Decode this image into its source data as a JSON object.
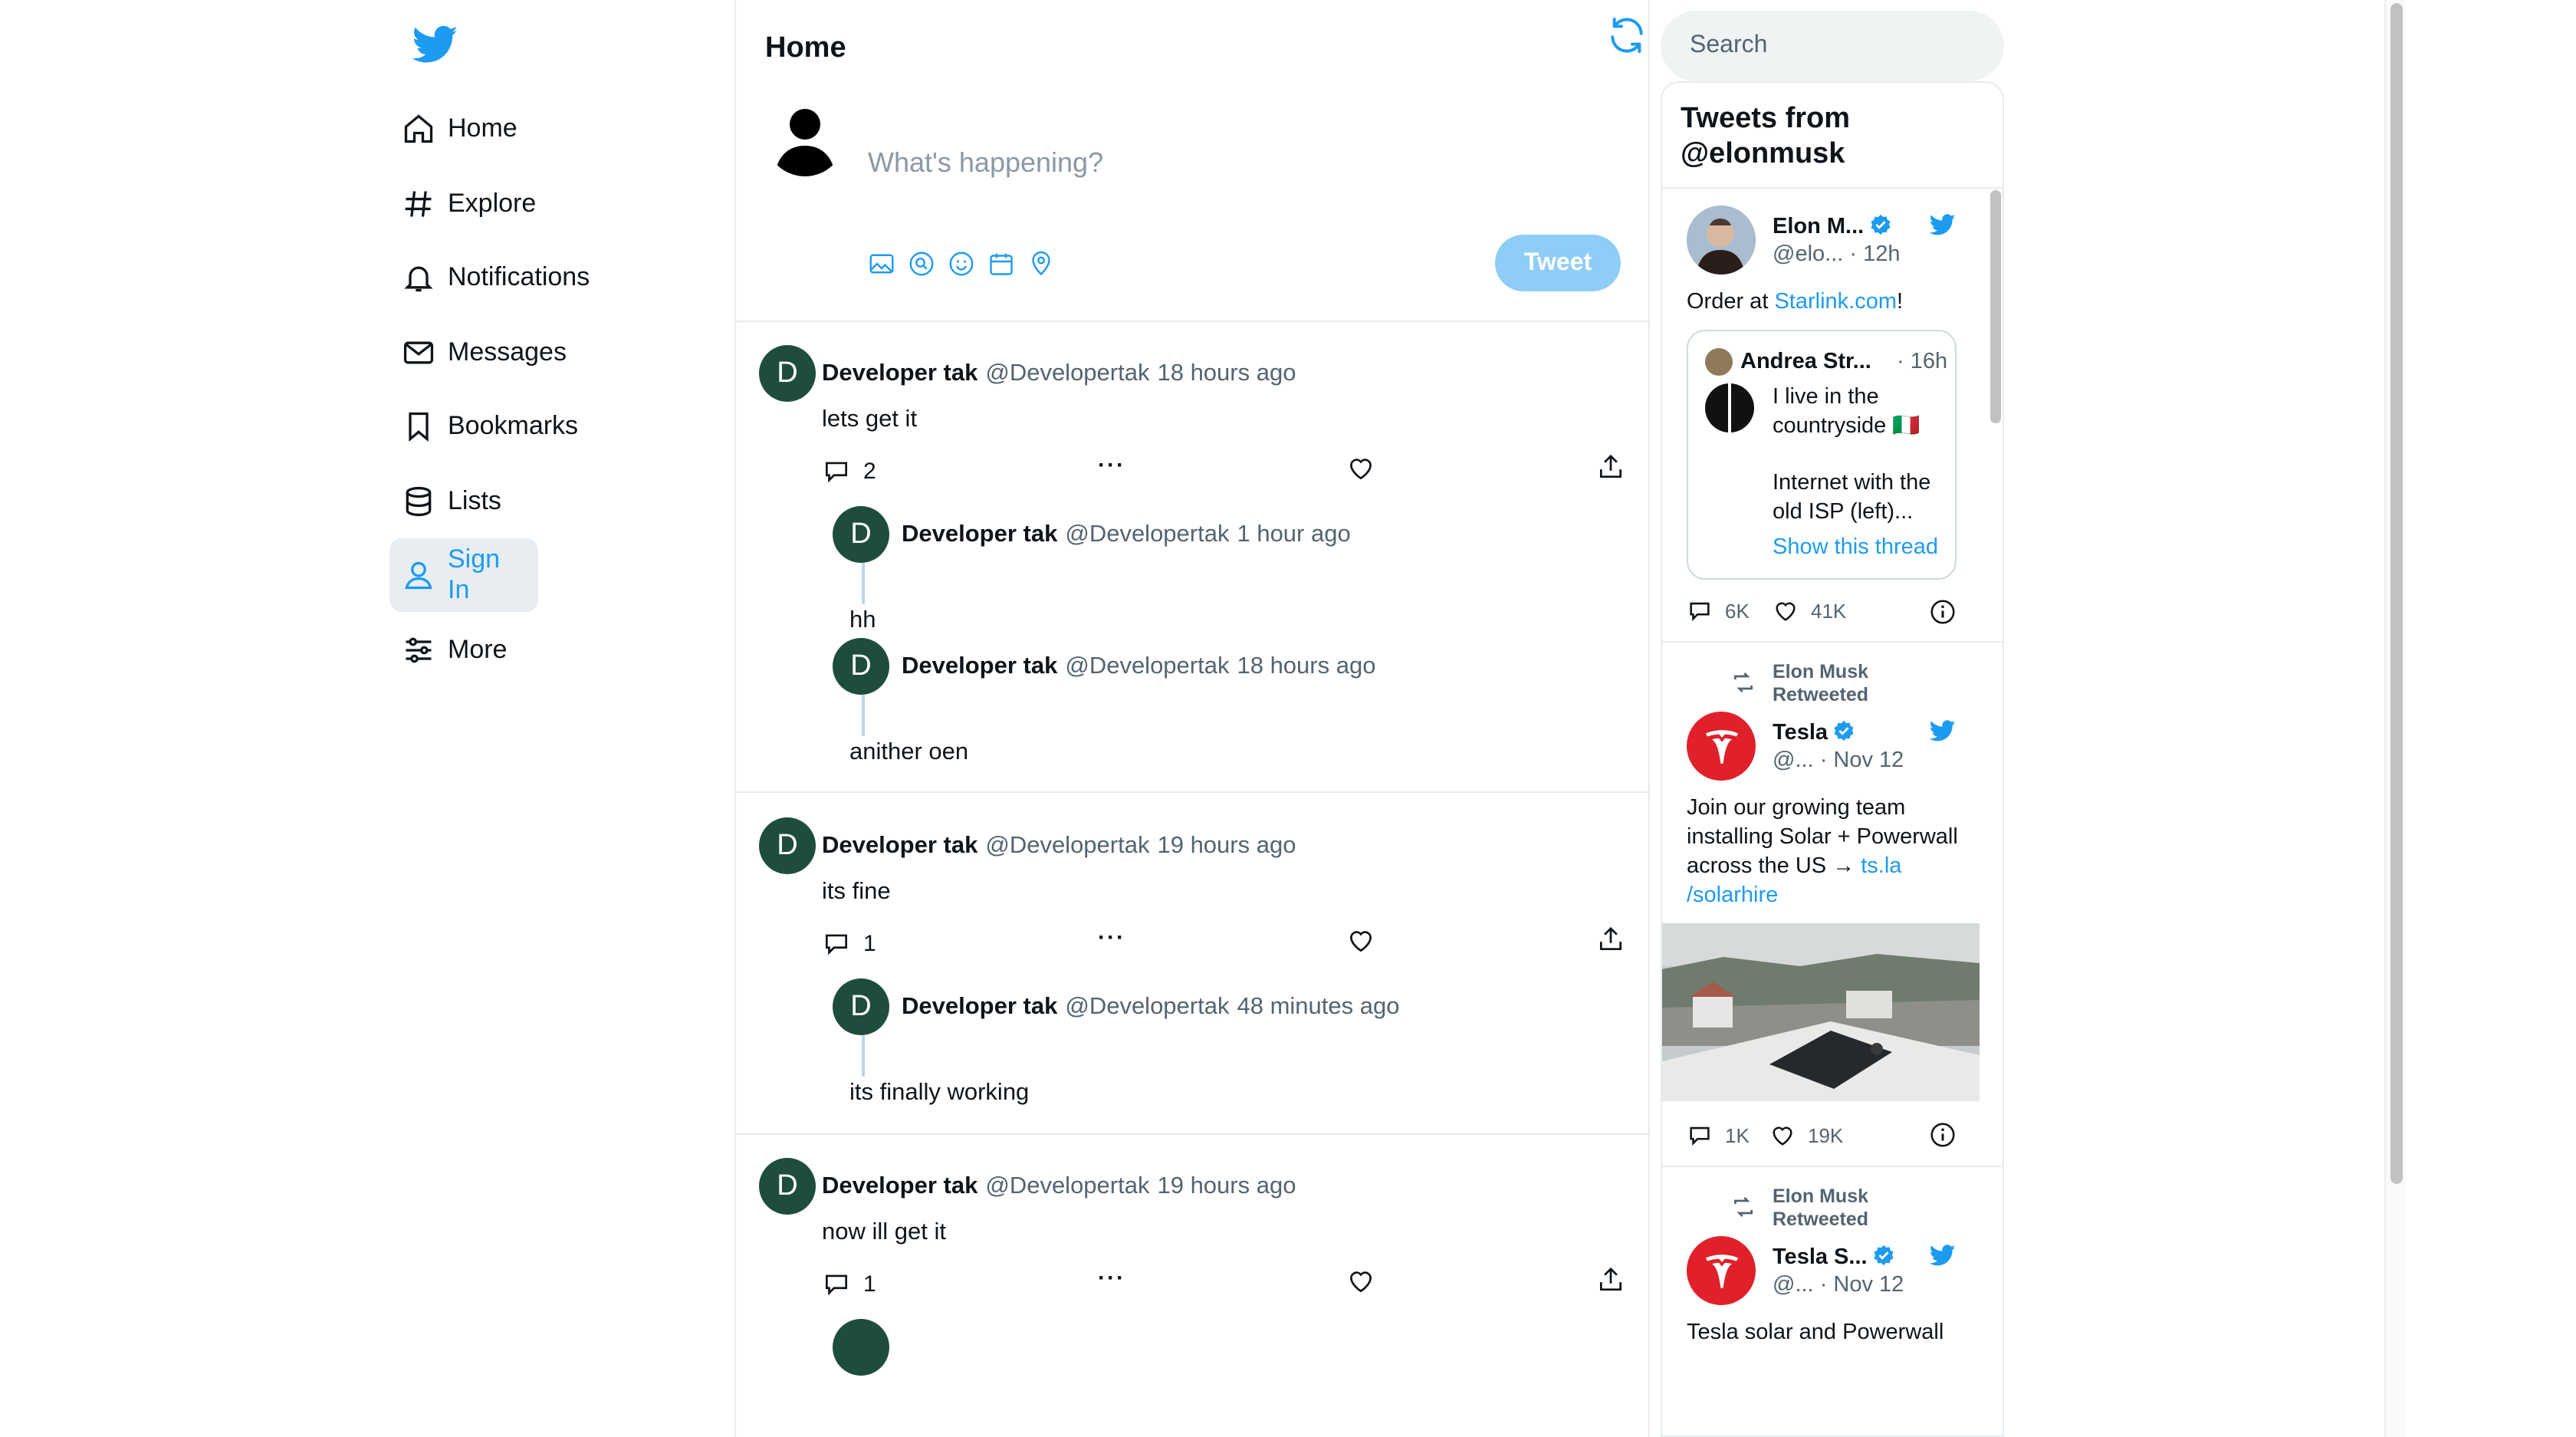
{
  "nav": {
    "items": [
      {
        "label": "Home",
        "icon": "home-icon"
      },
      {
        "label": "Explore",
        "icon": "hashtag-icon"
      },
      {
        "label": "Notifications",
        "icon": "bell-icon"
      },
      {
        "label": "Messages",
        "icon": "envelope-icon"
      },
      {
        "label": "Bookmarks",
        "icon": "bookmark-icon"
      },
      {
        "label": "Lists",
        "icon": "lists-icon"
      },
      {
        "label": "Sign In",
        "icon": "user-icon"
      },
      {
        "label": "More",
        "icon": "sliders-icon"
      }
    ],
    "active": "Sign In"
  },
  "main": {
    "title": "Home",
    "composer": {
      "placeholder": "What's happening?",
      "tweet_label": "Tweet"
    },
    "posts": [
      {
        "avatar": "D",
        "name": "Developer tak",
        "handle": "@Developertak",
        "time": "18 hours ago",
        "text": "lets get it",
        "replies": "2",
        "thread": [
          {
            "avatar": "D",
            "name": "Developer tak",
            "handle": "@Developertak",
            "time": "1 hour ago",
            "text": "hh"
          },
          {
            "avatar": "D",
            "name": "Developer tak",
            "handle": "@Developertak",
            "time": "18 hours ago",
            "text": "anither oen"
          }
        ]
      },
      {
        "avatar": "D",
        "name": "Developer tak",
        "handle": "@Developertak",
        "time": "19 hours ago",
        "text": "its fine",
        "replies": "1",
        "thread": [
          {
            "avatar": "D",
            "name": "Developer tak",
            "handle": "@Developertak",
            "time": "48 minutes ago",
            "text": "its finally working"
          }
        ]
      },
      {
        "avatar": "D",
        "name": "Developer tak",
        "handle": "@Developertak",
        "time": "19 hours ago",
        "text": "now ill get it",
        "replies": "1",
        "thread": []
      }
    ]
  },
  "sidebar": {
    "search_placeholder": "Search",
    "widget_title": "Tweets from @elonmusk",
    "tweets": [
      {
        "name": "Elon M...",
        "handle": "@elo...",
        "time": "· 12h",
        "text_prefix": "Order at ",
        "link": "Starlink.com",
        "text_suffix": "!",
        "quote": {
          "name": "Andrea Str...",
          "time": "· 16h",
          "text1": "I live in the countryside 🇮🇹",
          "text2": "Internet with the old ISP (left)...",
          "show_thread": "Show this thread"
        },
        "replies": "6K",
        "likes": "41K"
      },
      {
        "retweeted_by": "Elon Musk Retweeted",
        "name": "Tesla",
        "handle": "@...",
        "time": "· Nov 12",
        "text": "Join our growing team installing Solar + Powerwall across the US →",
        "link1": "ts.la",
        "link2": "/solarhire",
        "replies": "1K",
        "likes": "19K"
      },
      {
        "retweeted_by": "Elon Musk Retweeted",
        "name": "Tesla S...",
        "handle": "@...",
        "time": "· Nov 12",
        "text": "Tesla solar and Powerwall"
      }
    ]
  },
  "colors": {
    "accent": "#1d9bf0",
    "avatar_bg": "#1e4d3c",
    "tweet_btn_disabled": "#8ecdf8",
    "tesla_red": "#e0212b"
  }
}
